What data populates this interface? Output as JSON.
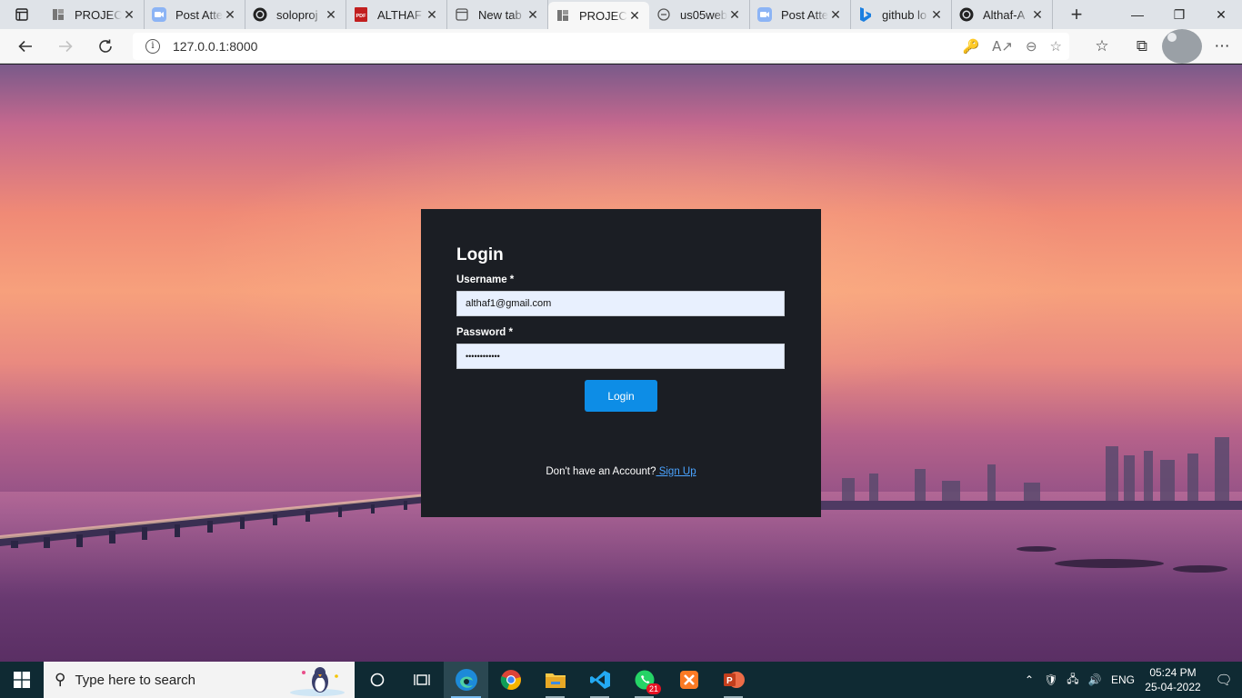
{
  "browser": {
    "tabs": [
      {
        "title": "PROJECT",
        "icon": "page-icon",
        "active": false
      },
      {
        "title": "Post Atte",
        "icon": "zoom-icon",
        "active": false
      },
      {
        "title": "soloproj",
        "icon": "github-icon",
        "active": false
      },
      {
        "title": "ALTHAF",
        "icon": "pdf-icon",
        "active": false
      },
      {
        "title": "New tab",
        "icon": "new-tab-icon",
        "active": false
      },
      {
        "title": "PROJECT",
        "icon": "page-icon",
        "active": true
      },
      {
        "title": "us05web",
        "icon": "link-icon",
        "active": false
      },
      {
        "title": "Post Atte",
        "icon": "zoom-icon",
        "active": false
      },
      {
        "title": "github lo",
        "icon": "bing-icon",
        "active": false
      },
      {
        "title": "Althaf-A",
        "icon": "github-icon",
        "active": false
      }
    ],
    "close_glyph": "✕",
    "new_tab_glyph": "+",
    "url": "127.0.0.1:8000"
  },
  "login": {
    "heading": "Login",
    "username_label": "Username *",
    "username_value": "althaf1@gmail.com",
    "password_label": "Password *",
    "password_value": "••••••••••••",
    "submit_label": "Login",
    "signup_prompt": "Don't have an Account?",
    "signup_link": " Sign Up"
  },
  "taskbar": {
    "search_placeholder": "Type here to search",
    "whatsapp_badge": "21",
    "language": "ENG",
    "time": "05:24 PM",
    "date": "25-04-2022"
  }
}
